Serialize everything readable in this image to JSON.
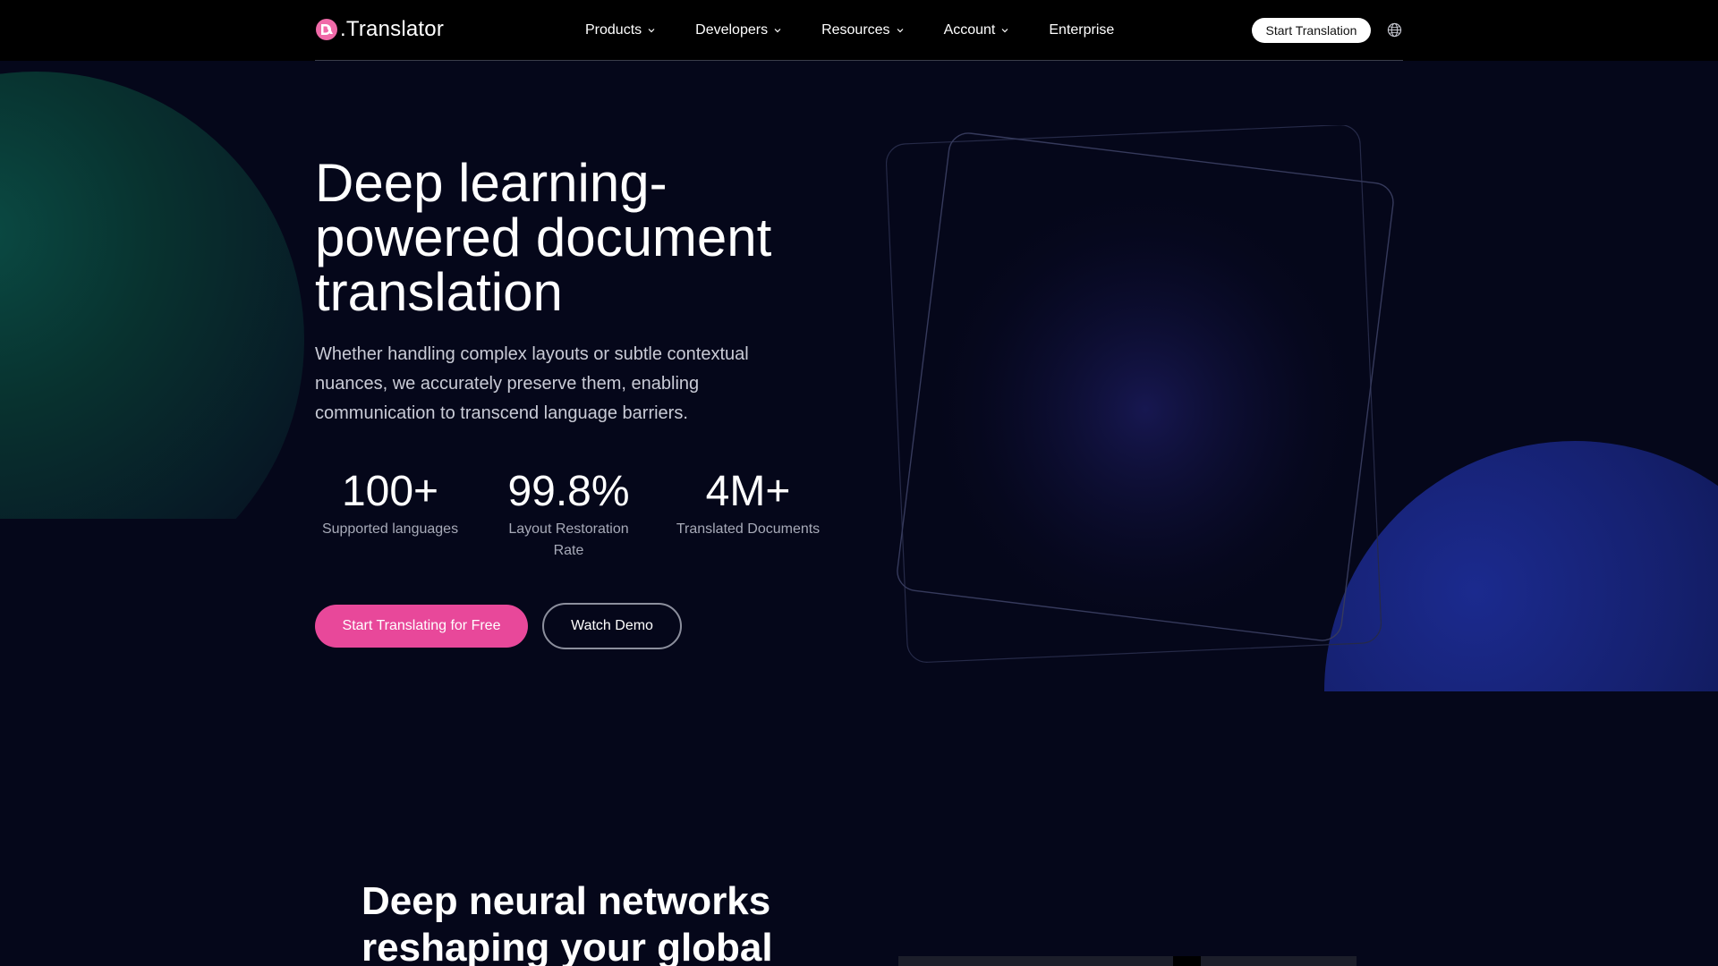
{
  "header": {
    "logo_text": ".Translator",
    "nav": [
      {
        "label": "Products",
        "dropdown": true
      },
      {
        "label": "Developers",
        "dropdown": true
      },
      {
        "label": "Resources",
        "dropdown": true
      },
      {
        "label": "Account",
        "dropdown": true
      },
      {
        "label": "Enterprise",
        "dropdown": false
      }
    ],
    "cta_label": "Start Translation",
    "language_icon": "globe-icon"
  },
  "hero": {
    "title": "Deep learning-powered document translation",
    "description": "Whether handling complex layouts or subtle contextual nuances, we accurately preserve them, enabling communication to transcend language barriers.",
    "stats": [
      {
        "value": "100+",
        "label": "Supported languages"
      },
      {
        "value": "99.8%",
        "label": "Layout Restoration Rate"
      },
      {
        "value": "4M+",
        "label": "Translated Documents"
      }
    ],
    "primary_button": "Start Translating for Free",
    "secondary_button": "Watch Demo"
  },
  "section2": {
    "title": "Deep neural networks reshaping your global"
  },
  "colors": {
    "accent_pink": "#e8489a",
    "background": "#05071a",
    "header_bg": "#000000"
  }
}
